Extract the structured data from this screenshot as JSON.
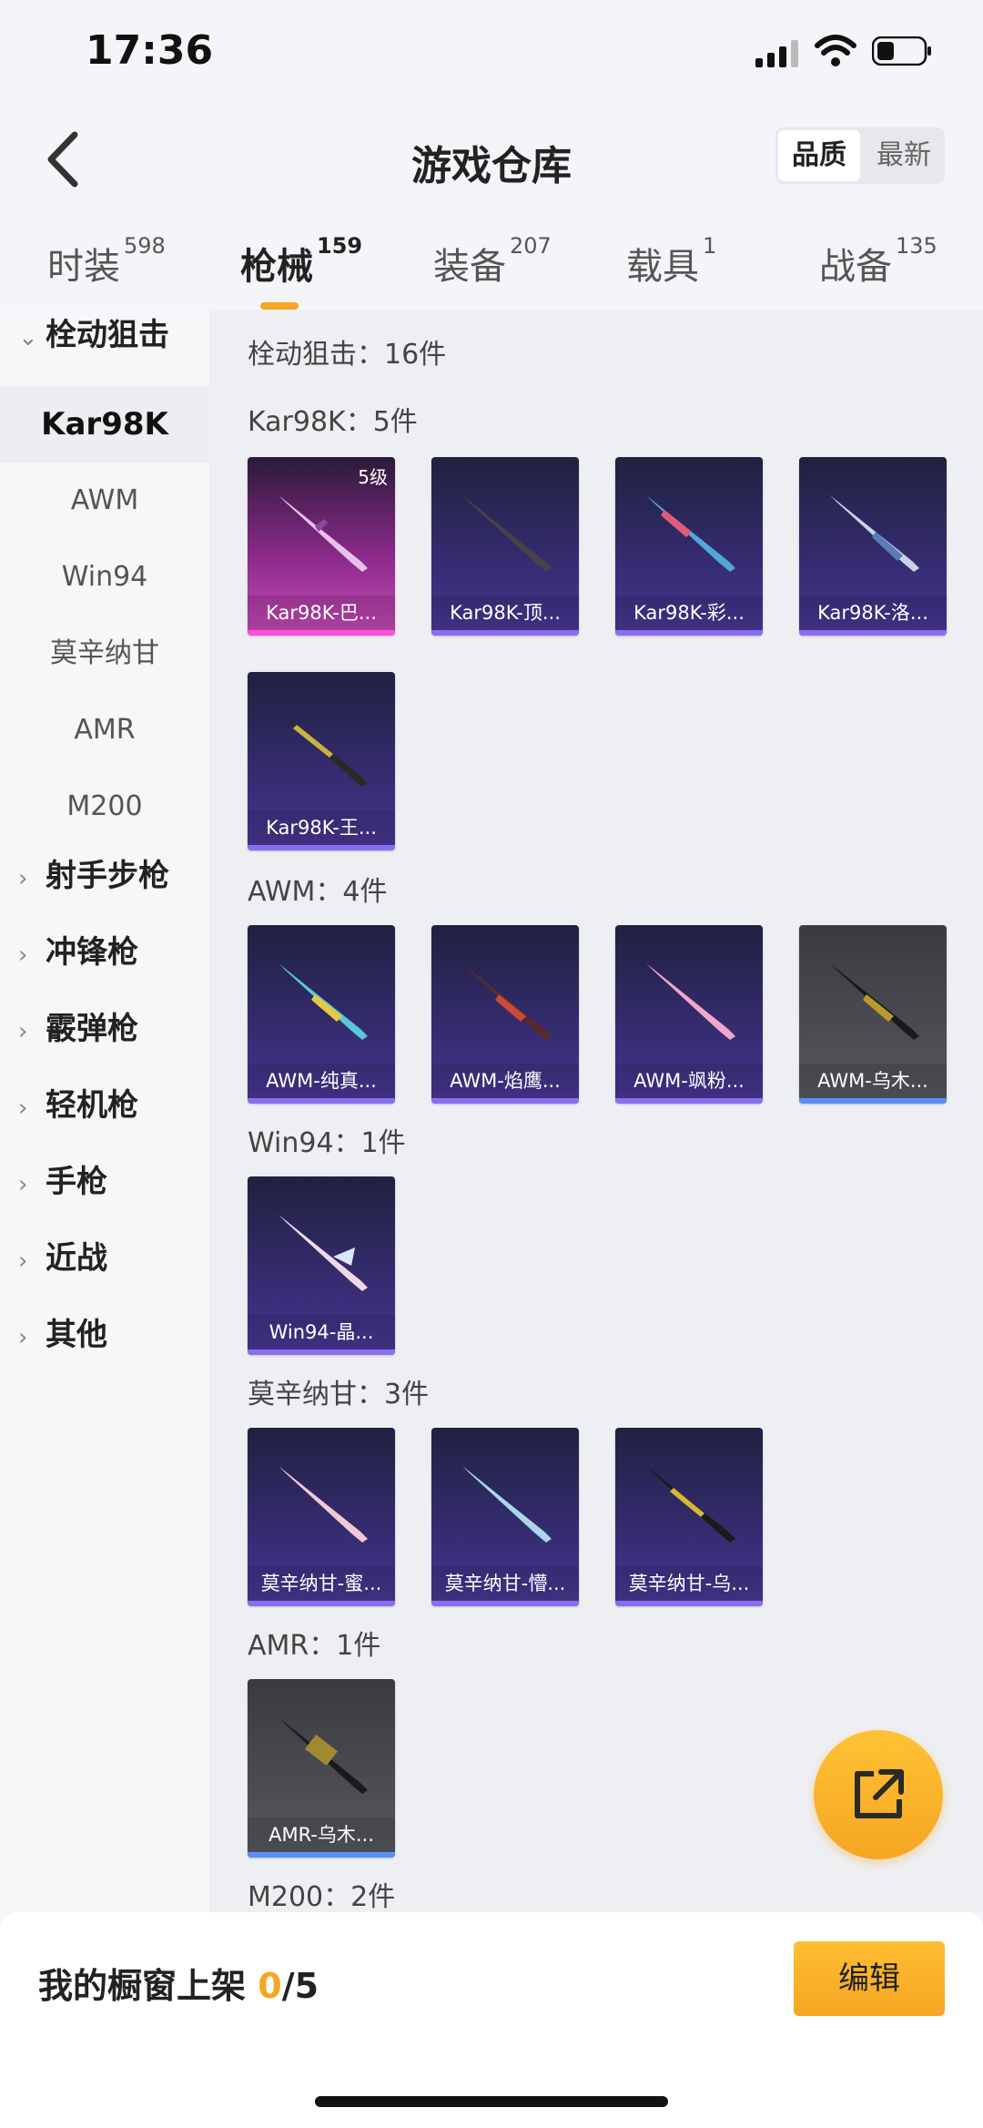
{
  "status_bar": {
    "time": "17:36"
  },
  "header": {
    "title": "游戏仓库",
    "sort_options": [
      "品质",
      "最新"
    ]
  },
  "tabs": [
    {
      "label": "时装",
      "count": "598"
    },
    {
      "label": "枪械",
      "count": "159"
    },
    {
      "label": "装备",
      "count": "207"
    },
    {
      "label": "载具",
      "count": "1"
    },
    {
      "label": "战备",
      "count": "135"
    }
  ],
  "sidebar": {
    "groups": [
      {
        "label": "栓动狙击",
        "expanded": true,
        "items": [
          "Kar98K",
          "AWM",
          "Win94",
          "莫辛纳甘",
          "AMR",
          "M200"
        ]
      },
      {
        "label": "射手步枪"
      },
      {
        "label": "冲锋枪"
      },
      {
        "label": "霰弹枪"
      },
      {
        "label": "轻机枪"
      },
      {
        "label": "手枪"
      },
      {
        "label": "近战"
      },
      {
        "label": "其他"
      }
    ]
  },
  "main": {
    "category_header": "栓动狙击：16件",
    "sections": [
      {
        "title": "Kar98K：5件",
        "items": [
          {
            "label": "Kar98K-巴...",
            "level": "5级",
            "rarity": "pink"
          },
          {
            "label": "Kar98K-顶...",
            "rarity": "purple"
          },
          {
            "label": "Kar98K-彩...",
            "rarity": "purple"
          },
          {
            "label": "Kar98K-洛...",
            "rarity": "purple"
          },
          {
            "label": "Kar98K-王...",
            "rarity": "purple"
          }
        ]
      },
      {
        "title": "AWM：4件",
        "items": [
          {
            "label": "AWM-纯真...",
            "rarity": "purple"
          },
          {
            "label": "AWM-焰鹰...",
            "rarity": "purple"
          },
          {
            "label": "AWM-飒粉...",
            "rarity": "purple"
          },
          {
            "label": "AWM-乌木...",
            "rarity": "gray"
          }
        ]
      },
      {
        "title": "Win94：1件",
        "items": [
          {
            "label": "Win94-晶...",
            "rarity": "purple"
          }
        ]
      },
      {
        "title": "莫辛纳甘：3件",
        "items": [
          {
            "label": "莫辛纳甘-蜜...",
            "rarity": "purple"
          },
          {
            "label": "莫辛纳甘-懵...",
            "rarity": "purple"
          },
          {
            "label": "莫辛纳甘-乌...",
            "rarity": "purple"
          }
        ]
      },
      {
        "title": "AMR：1件",
        "items": [
          {
            "label": "AMR-乌木...",
            "rarity": "gray"
          }
        ]
      },
      {
        "title": "M200：2件",
        "items": []
      }
    ]
  },
  "bottom_bar": {
    "shelf_label": "我的橱窗上架",
    "shelf_count": "0",
    "shelf_total": "/5",
    "edit_label": "编辑"
  },
  "icons": {
    "fab": "share-external-icon",
    "back": "chevron-left-icon"
  },
  "colors": {
    "accent": "#f5a623",
    "purple_rarity": "#8b6df0",
    "pink_rarity": "#ff4fd8",
    "gray_rarity": "#5b8ef5"
  }
}
